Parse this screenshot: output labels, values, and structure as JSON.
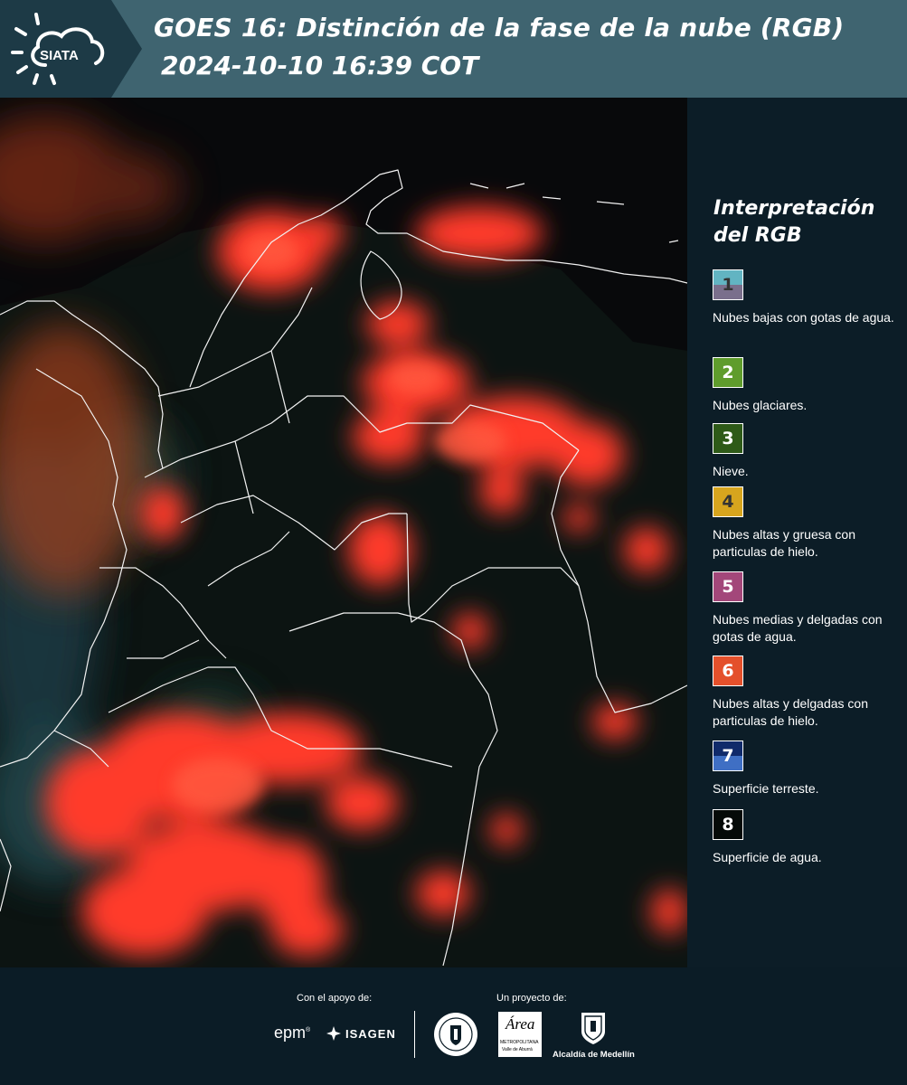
{
  "header": {
    "logo_text": "SIATA",
    "title_line1": "GOES 16: Distinción de la fase de la nube (RGB)",
    "title_line2": "2024-10-10 16:39 COT"
  },
  "legend": {
    "title_line1": "Interpretación",
    "title_line2": "del RGB",
    "items": [
      {
        "num": "1",
        "text": "Nubes bajas con gotas de agua.",
        "color_top": "#62b4c2",
        "color_bottom": "#7a6f8c",
        "num_color": "#333333"
      },
      {
        "num": "2",
        "text": "Nubes glaciares.",
        "color": "#5f9c2c",
        "num_color": "#ffffff"
      },
      {
        "num": "3",
        "text": "Nieve.",
        "color": "#2e5a18",
        "num_color": "#ffffff"
      },
      {
        "num": "4",
        "text": "Nubes altas y gruesa con particulas de hielo.",
        "color": "#d7a51e",
        "num_color": "#333333"
      },
      {
        "num": "5",
        "text": "Nubes medias y delgadas con gotas de agua.",
        "color": "#a3477a",
        "num_color": "#ffffff"
      },
      {
        "num": "6",
        "text": "Nubes altas y delgadas con particulas de hielo.",
        "color": "#e4502b",
        "num_color": "#ffffff"
      },
      {
        "num": "7",
        "text": "Superficie terreste.",
        "color_top": "#102a6a",
        "color_bottom": "#3f6fc4",
        "num_color": "#ffffff"
      },
      {
        "num": "8",
        "text": "Superficie de agua.",
        "color": "#050a08",
        "num_color": "#ffffff"
      }
    ]
  },
  "footer": {
    "support_label": "Con el apoyo de:",
    "project_label": "Un proyecto de:",
    "sponsor_epm": "epm",
    "sponsor_isagen": "ISAGEN",
    "area_logo_text": "Área",
    "area_sub1": "METROPOLITANA",
    "area_sub2": "Valle de Aburrá",
    "alcaldia": "Alcaldía de Medellín"
  },
  "colors": {
    "header_bg": "#3f6470",
    "header_dark": "#1d3a46",
    "legend_bg": "#0c1d27",
    "cloud_red": "#ff3a2a"
  }
}
